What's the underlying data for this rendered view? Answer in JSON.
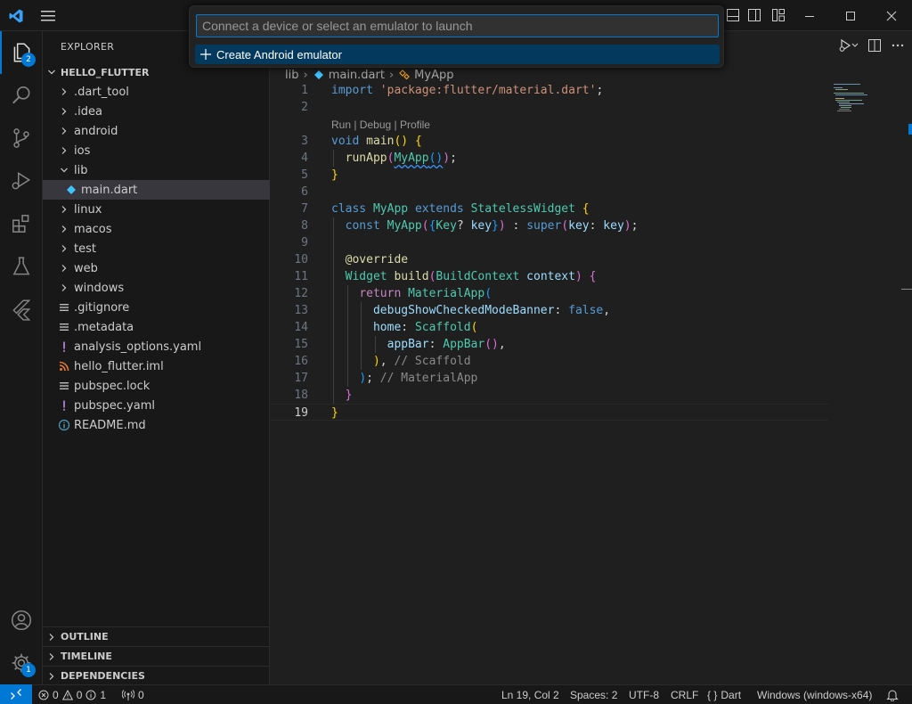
{
  "quickpick": {
    "placeholder": "Connect a device or select an emulator to launch",
    "items": [
      {
        "label": "Create Android emulator"
      }
    ]
  },
  "activity": {
    "explorer_badge": "2",
    "settings_badge": "1"
  },
  "sidebar": {
    "title": "EXPLORER",
    "root": "HELLO_FLUTTER",
    "tree": [
      {
        "label": ".dart_tool",
        "type": "folder",
        "depth": 1,
        "expanded": false
      },
      {
        "label": ".idea",
        "type": "folder",
        "depth": 1,
        "expanded": false
      },
      {
        "label": "android",
        "type": "folder",
        "depth": 1,
        "expanded": false
      },
      {
        "label": "ios",
        "type": "folder",
        "depth": 1,
        "expanded": false
      },
      {
        "label": "lib",
        "type": "folder",
        "depth": 1,
        "expanded": true
      },
      {
        "label": "main.dart",
        "type": "dart",
        "depth": 2,
        "selected": true
      },
      {
        "label": "linux",
        "type": "folder",
        "depth": 1,
        "expanded": false
      },
      {
        "label": "macos",
        "type": "folder",
        "depth": 1,
        "expanded": false
      },
      {
        "label": "test",
        "type": "folder",
        "depth": 1,
        "expanded": false
      },
      {
        "label": "web",
        "type": "folder",
        "depth": 1,
        "expanded": false
      },
      {
        "label": "windows",
        "type": "folder",
        "depth": 1,
        "expanded": false
      },
      {
        "label": ".gitignore",
        "type": "git",
        "depth": 1
      },
      {
        "label": ".metadata",
        "type": "lines",
        "depth": 1
      },
      {
        "label": "analysis_options.yaml",
        "type": "yaml",
        "depth": 1
      },
      {
        "label": "hello_flutter.iml",
        "type": "rss",
        "depth": 1
      },
      {
        "label": "pubspec.lock",
        "type": "lines",
        "depth": 1
      },
      {
        "label": "pubspec.yaml",
        "type": "yaml",
        "depth": 1
      },
      {
        "label": "README.md",
        "type": "info",
        "depth": 1
      }
    ],
    "sections": [
      "OUTLINE",
      "TIMELINE",
      "DEPENDENCIES"
    ]
  },
  "editor": {
    "breadcrumb": {
      "folder": "lib",
      "file": "main.dart",
      "symbol": "MyApp"
    },
    "codelens": "Run | Debug | Profile",
    "current_line": 19,
    "line_numbers": [
      "1",
      "2",
      "3",
      "4",
      "5",
      "6",
      "7",
      "8",
      "9",
      "10",
      "11",
      "12",
      "13",
      "14",
      "15",
      "16",
      "17",
      "18",
      "19"
    ],
    "code": {
      "l1_import": "import",
      "l1_str": "'package:flutter/material.dart'",
      "l3_void": "void",
      "l3_main": "main",
      "l4_runapp": "runApp",
      "l4_myapp": "MyApp",
      "l7_class": "class",
      "l7_name": "MyApp",
      "l7_extends": "extends",
      "l7_base": "StatelessWidget",
      "l8_const": "const",
      "l8_name": "MyApp",
      "l8_key_type": "Key",
      "l8_key": "key",
      "l8_super": "super",
      "l8_key_label": "key",
      "l8_key_val": "key",
      "l10_override": "@override",
      "l11_widget": "Widget",
      "l11_build": "build",
      "l11_ctx_type": "BuildContext",
      "l11_ctx": "context",
      "l12_return": "return",
      "l12_material": "MaterialApp",
      "l13_prop": "debugShowCheckedModeBanner",
      "l13_val": "false",
      "l14_prop": "home",
      "l14_val": "Scaffold",
      "l15_prop": "appBar",
      "l15_val": "AppBar",
      "l16_comment": "// Scaffold",
      "l17_comment": "// MaterialApp"
    }
  },
  "status": {
    "errors": "0",
    "warnings": "0",
    "infos": "1",
    "ports": "0",
    "position": "Ln 19, Col 2",
    "spaces": "Spaces: 2",
    "encoding": "UTF-8",
    "eol": "CRLF",
    "language": "Dart",
    "device": "Windows (windows-x64)"
  }
}
